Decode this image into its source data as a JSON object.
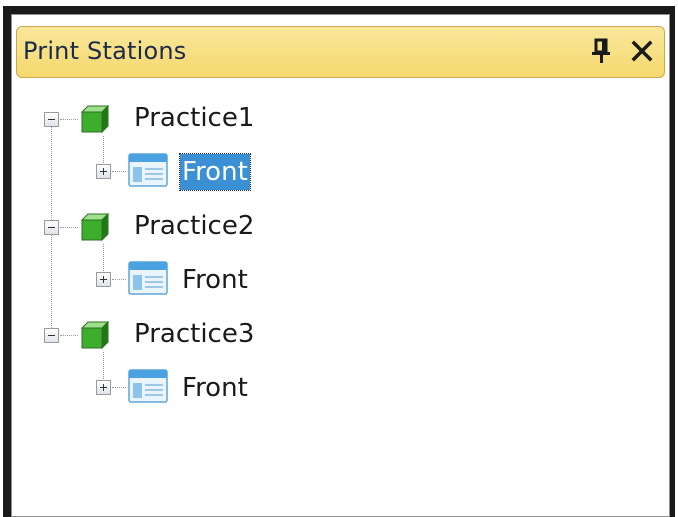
{
  "panel": {
    "title": "Print Stations",
    "pin_icon": "pin-icon",
    "close_icon": "close-icon"
  },
  "tree": {
    "nodes": [
      {
        "label": "Practice1",
        "icon": "cube-icon",
        "expanded": true,
        "children": [
          {
            "label": "Front",
            "icon": "window-icon",
            "expanded": false,
            "selected": true
          }
        ]
      },
      {
        "label": "Practice2",
        "icon": "cube-icon",
        "expanded": true,
        "children": [
          {
            "label": "Front",
            "icon": "window-icon",
            "expanded": false,
            "selected": false
          }
        ]
      },
      {
        "label": "Practice3",
        "icon": "cube-icon",
        "expanded": true,
        "children": [
          {
            "label": "Front",
            "icon": "window-icon",
            "expanded": false,
            "selected": false
          }
        ]
      }
    ]
  },
  "colors": {
    "titlebar": "#f5d86e",
    "selection": "#3b8fd4"
  }
}
